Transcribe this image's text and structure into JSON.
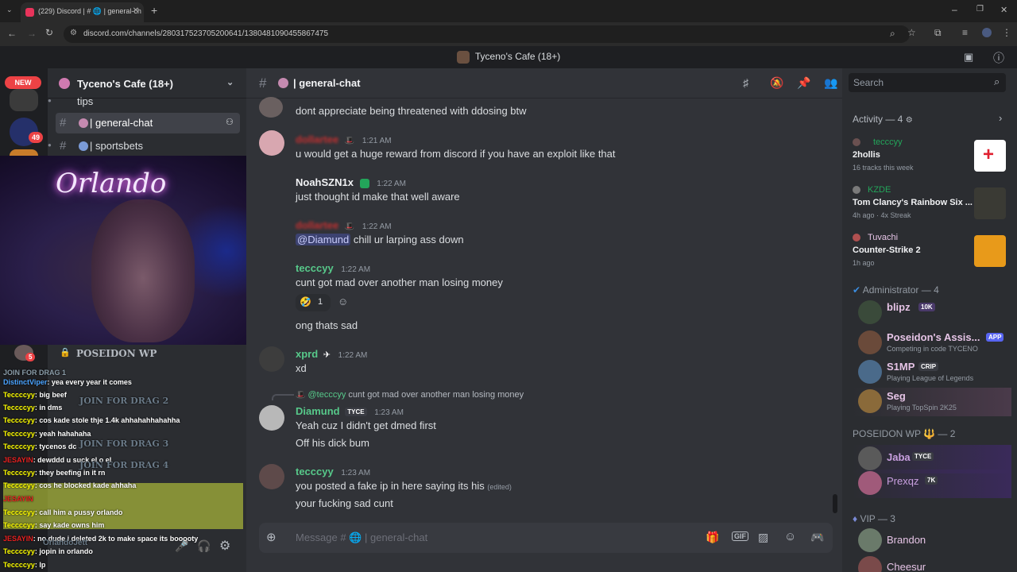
{
  "browser": {
    "tab_title": "(229) Discord | # 🌐 | general-ch",
    "url": "discord.com/channels/280317523705200641/1380481090455867475"
  },
  "discord": {
    "top_title": "Tyceno's Cafe (18+)",
    "server_badge_new": "NEW",
    "server_badge_count": "49",
    "server_name": "Tyceno's Cafe (18+)",
    "channels": [
      {
        "label": "tips"
      },
      {
        "label": "| general-chat"
      },
      {
        "label": "| sportsbets"
      }
    ],
    "voice_header": "POSEIDON WP",
    "voice_badge": "5",
    "chat_header_name": "| general-chat",
    "search_placeholder": "Search",
    "message_placeholder": "Message # 🌐 | general-chat",
    "messages": [
      {
        "author": "",
        "time": "",
        "text": "dont appreciate being threatened with ddosing btw"
      },
      {
        "author": "dollartee",
        "time": "1:21 AM",
        "text": "u would get a huge reward from discord if you have an exploit like that"
      },
      {
        "author": "NoahSZN1x",
        "time": "1:22 AM",
        "text": "just thought id make that well aware"
      },
      {
        "author": "dollartee",
        "time": "1:22 AM",
        "mention": "@Diamund",
        "text": "chill ur larping ass down"
      },
      {
        "author": "tecccyy",
        "time": "1:22 AM",
        "text": "cunt got mad over another man losing money",
        "reaction_count": "1"
      },
      {
        "author": "",
        "time": "",
        "text": "ong thats sad"
      },
      {
        "author": "xprd",
        "time": "1:22 AM",
        "text": "xd"
      },
      {
        "reply_to": "@tecccyy",
        "reply_text": "cunt got mad over another man losing money",
        "author": "Diamund",
        "tag": "TYCE",
        "time": "1:23 AM",
        "text": "Yeah cuz I didn't get dmed first",
        "text2": "Off his dick bum"
      },
      {
        "author": "tecccyy",
        "time": "1:23 AM",
        "text": "you posted a fake ip in here saying its his",
        "edited": "(edited)",
        "text2": "your fucking sad cunt"
      }
    ],
    "activity": {
      "header": "Activity — 4",
      "items": [
        {
          "user": "tecccyy",
          "game": "2hollis",
          "sub": "16 tracks this week"
        },
        {
          "user": "KZDE",
          "game": "Tom Clancy's Rainbow Six ...",
          "sub": "4h ago  · 4x Streak"
        },
        {
          "user": "Tuvachi",
          "game": "Counter-Strike 2",
          "sub": "1h ago"
        }
      ]
    },
    "groups": [
      {
        "header": "Administrator — 4",
        "members": [
          {
            "name": "blipz",
            "badge": "10K",
            "status": ""
          },
          {
            "name": "Poseidon's Assis...",
            "badge": "APP",
            "status": "Competing in code TYCENO"
          },
          {
            "name": "S1MP",
            "badge": "CRIP",
            "status": "Playing League of Legends"
          },
          {
            "name": "Seg",
            "badge": "",
            "status": "Playing TopSpin 2K25"
          }
        ]
      },
      {
        "header": "POSEIDON WP 🔱 — 2",
        "members": [
          {
            "name": "Jaba",
            "badge": "TYCE",
            "status": ""
          },
          {
            "name": "Prexqz",
            "badge": "7K",
            "status": ""
          }
        ]
      },
      {
        "header": "VIP — 3",
        "members": [
          {
            "name": "Brandon",
            "badge": "",
            "status": ""
          },
          {
            "name": "Cheesur",
            "badge": "",
            "status": ""
          }
        ]
      }
    ]
  },
  "stream_overlay": {
    "neon_sign": "Orlando",
    "join_lines": [
      "JOIN FOR DRAG 1",
      "JOIN FOR DRAG 2",
      "JOIN FOR DRAG 3",
      "JOIN FOR DRAG 4"
    ],
    "chat": [
      {
        "user": "DistinctViper",
        "text": ": yea every year it comes"
      },
      {
        "user": "Teccccyy",
        "text": ": big beef"
      },
      {
        "user": "Teccccyy",
        "text": ": in dms"
      },
      {
        "user": "Teccccyy",
        "text": ": cos kade stole thje 1.4k ahhahahhahahha"
      },
      {
        "user": "Teccccyy",
        "text": ": yeah hahahaha"
      },
      {
        "user": "Teccccyy",
        "text": ": tycenos dc"
      },
      {
        "user": "JESAYIN",
        "text": ": dewddd u suck el o el"
      },
      {
        "user": "Teccccyy",
        "text": ": they beefing in it rn"
      },
      {
        "user": "Teccccyy",
        "text": ": cos he blocked kade ahhaha"
      },
      {
        "user": "JESAYIN",
        "text": ""
      },
      {
        "user": "Teccccyy",
        "text": ": call him a pussy orlando"
      },
      {
        "user": "Teccccyy",
        "text": ": say kade owns him"
      },
      {
        "user": "JESAYIN",
        "text": ": no dude i deleted 2k to make space its booooty"
      },
      {
        "user": "Teccccyy",
        "text": ": jopin in orlando"
      },
      {
        "user": "Teccccyy",
        "text": ": lp"
      }
    ],
    "user_label": "OrlandoJett"
  }
}
